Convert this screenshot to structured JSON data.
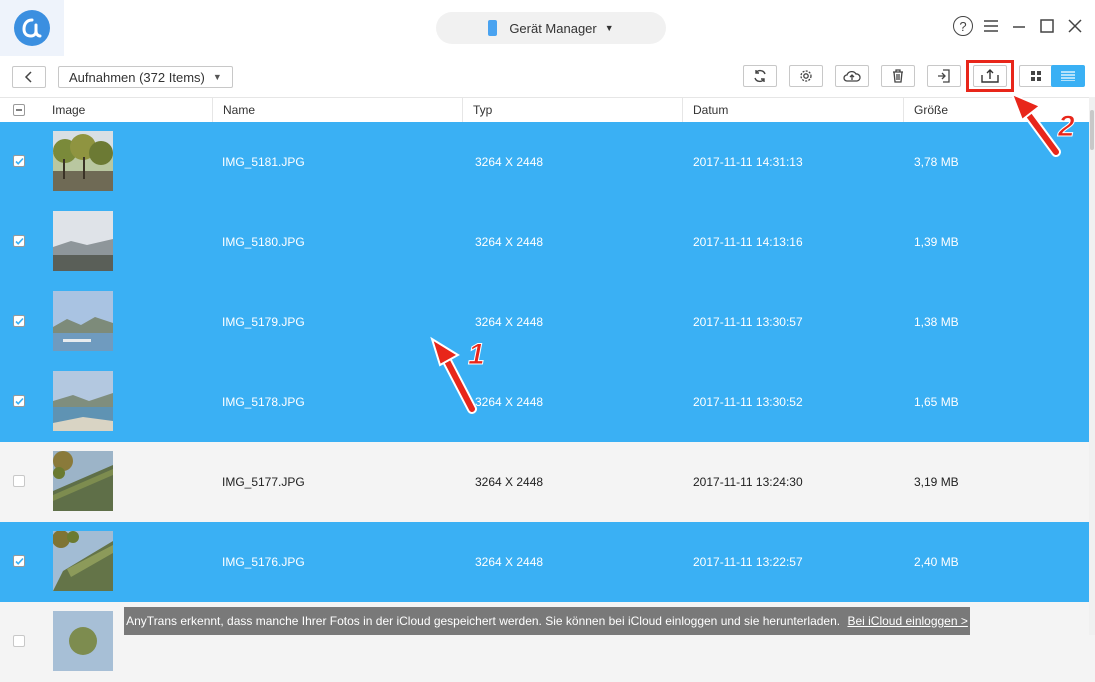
{
  "titlebar": {
    "device_label": "Gerät Manager",
    "help_glyph": "?"
  },
  "toolbar": {
    "breadcrumb": "Aufnahmen (372 Items)",
    "buttons": [
      "refresh-icon",
      "settings-icon",
      "cloud-upload-icon",
      "trash-icon",
      "import-icon",
      "export-to-pc-icon",
      "grid-view-icon",
      "list-view-icon"
    ]
  },
  "table": {
    "headers": {
      "image": "Image",
      "name": "Name",
      "type": "Typ",
      "date": "Datum",
      "size": "Größe"
    },
    "rows": [
      {
        "name": "IMG_5181.JPG",
        "type": "3264 X 2448",
        "date": "2017-11-11 14:31:13",
        "size": "3,78 MB",
        "selected": true
      },
      {
        "name": "IMG_5180.JPG",
        "type": "3264 X 2448",
        "date": "2017-11-11 14:13:16",
        "size": "1,39 MB",
        "selected": true
      },
      {
        "name": "IMG_5179.JPG",
        "type": "3264 X 2448",
        "date": "2017-11-11 13:30:57",
        "size": "1,38 MB",
        "selected": true
      },
      {
        "name": "IMG_5178.JPG",
        "type": "3264 X 2448",
        "date": "2017-11-11 13:30:52",
        "size": "1,65 MB",
        "selected": true
      },
      {
        "name": "IMG_5177.JPG",
        "type": "3264 X 2448",
        "date": "2017-11-11 13:24:30",
        "size": "3,19 MB",
        "selected": false
      },
      {
        "name": "IMG_5176.JPG",
        "type": "3264 X 2448",
        "date": "2017-11-11 13:22:57",
        "size": "2,40 MB",
        "selected": true
      }
    ]
  },
  "toast": {
    "message": "AnyTrans erkennt, dass manche Ihrer Fotos in der iCloud gespeichert werden. Sie können bei iCloud einloggen und sie herunterladen.",
    "link": "Bei iCloud einloggen >"
  },
  "annotations": {
    "step1": "1",
    "step2": "2"
  },
  "colors": {
    "selection": "#3ab0f4",
    "annotation": "#e8261a",
    "brand": "#3b8fe0"
  }
}
